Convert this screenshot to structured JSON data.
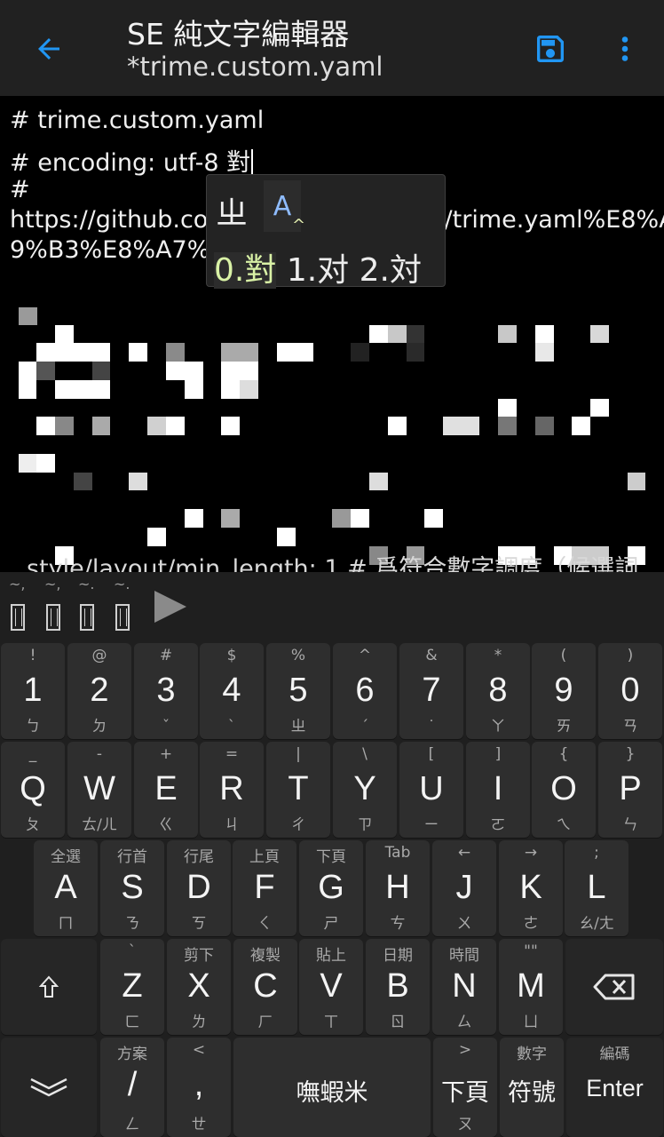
{
  "appbar": {
    "title": "SE 純文字編輯器",
    "subtitle": "*trime.custom.yaml",
    "accent_color": "#2196F3",
    "icons": [
      "arrow-left-icon",
      "save-icon",
      "more-vert-icon"
    ]
  },
  "editor": {
    "lines": [
      "# trime.custom.yaml",
      "# encoding: utf-8 對",
      "#",
      "https://github.com/osfans/trime/wiki/trime.yaml%E8%A",
      "9%B3%E8%A7%A"
    ],
    "partial_line": "style/layout/min_length: 1 # 爲符合數字調度（候選詞"
  },
  "candidate_popup": {
    "composition": "ㄓ",
    "ascii_mode": "A",
    "caret": "^",
    "first": "0.對",
    "rest": "1.对 2.対"
  },
  "keyboard": {
    "candidate_bar": {
      "items": [
        "~,",
        "~,",
        "~.",
        "~."
      ],
      "play_icon": "play-icon"
    },
    "row1": [
      {
        "top": "!",
        "main": "1",
        "bot": "ㄅ"
      },
      {
        "top": "@",
        "main": "2",
        "bot": "ㄉ"
      },
      {
        "top": "#",
        "main": "3",
        "bot": "ˇ"
      },
      {
        "top": "$",
        "main": "4",
        "bot": "ˋ"
      },
      {
        "top": "%",
        "main": "5",
        "bot": "ㄓ"
      },
      {
        "top": "^",
        "main": "6",
        "bot": "ˊ"
      },
      {
        "top": "&",
        "main": "7",
        "bot": "˙"
      },
      {
        "top": "*",
        "main": "8",
        "bot": "ㄚ"
      },
      {
        "top": "(",
        "main": "9",
        "bot": "ㄞ"
      },
      {
        "top": ")",
        "main": "0",
        "bot": "ㄢ"
      }
    ],
    "row2": [
      {
        "top": "_",
        "main": "Q",
        "bot": "ㄆ"
      },
      {
        "top": "-",
        "main": "W",
        "bot": "ㄊ/ㄦ"
      },
      {
        "top": "+",
        "main": "E",
        "bot": "ㄍ"
      },
      {
        "top": "=",
        "main": "R",
        "bot": "ㄐ"
      },
      {
        "top": "|",
        "main": "T",
        "bot": "ㄔ"
      },
      {
        "top": "\\",
        "main": "Y",
        "bot": "ㄗ"
      },
      {
        "top": "[",
        "main": "U",
        "bot": "ㄧ"
      },
      {
        "top": "]",
        "main": "I",
        "bot": "ㄛ"
      },
      {
        "top": "{",
        "main": "O",
        "bot": "ㄟ"
      },
      {
        "top": "}",
        "main": "P",
        "bot": "ㄣ"
      }
    ],
    "row3": [
      {
        "top": "全選",
        "main": "A",
        "bot": "ㄇ"
      },
      {
        "top": "行首",
        "main": "S",
        "bot": "ㄋ"
      },
      {
        "top": "行尾",
        "main": "D",
        "bot": "ㄎ"
      },
      {
        "top": "上頁",
        "main": "F",
        "bot": "ㄑ"
      },
      {
        "top": "下頁",
        "main": "G",
        "bot": "ㄕ"
      },
      {
        "top": "Tab",
        "main": "H",
        "bot": "ㄘ"
      },
      {
        "top": "←",
        "main": "J",
        "bot": "ㄨ"
      },
      {
        "top": "→",
        "main": "K",
        "bot": "ㄜ"
      },
      {
        "top": ";",
        "main": "L",
        "bot": "ㄠ/ㄤ"
      }
    ],
    "row4": [
      {
        "top": "`",
        "main": "Z",
        "bot": "ㄈ"
      },
      {
        "top": "剪下",
        "main": "X",
        "bot": "ㄌ"
      },
      {
        "top": "複製",
        "main": "C",
        "bot": "ㄏ"
      },
      {
        "top": "貼上",
        "main": "V",
        "bot": "ㄒ"
      },
      {
        "top": "日期",
        "main": "B",
        "bot": "ㄖ"
      },
      {
        "top": "時間",
        "main": "N",
        "bot": "ㄙ"
      },
      {
        "top": "\"\"",
        "main": "M",
        "bot": "ㄩ"
      }
    ],
    "row4_icons": {
      "shift": "shift-icon",
      "backspace": "backspace-icon"
    },
    "row5": {
      "collapse_icon": "chevron-double-down-icon",
      "slash": {
        "top": "方案",
        "main": "/",
        "bot": "ㄥ"
      },
      "comma": {
        "top": "<",
        "main": ",",
        "bot": "ㄝ"
      },
      "space": "嘸蝦米",
      "pagedown": {
        "top": ">",
        "main": "下頁",
        "bot": "ㄡ"
      },
      "symbols": {
        "top": "數字",
        "main": "符號"
      },
      "enter": {
        "top": "編碼",
        "main": "Enter"
      }
    }
  }
}
